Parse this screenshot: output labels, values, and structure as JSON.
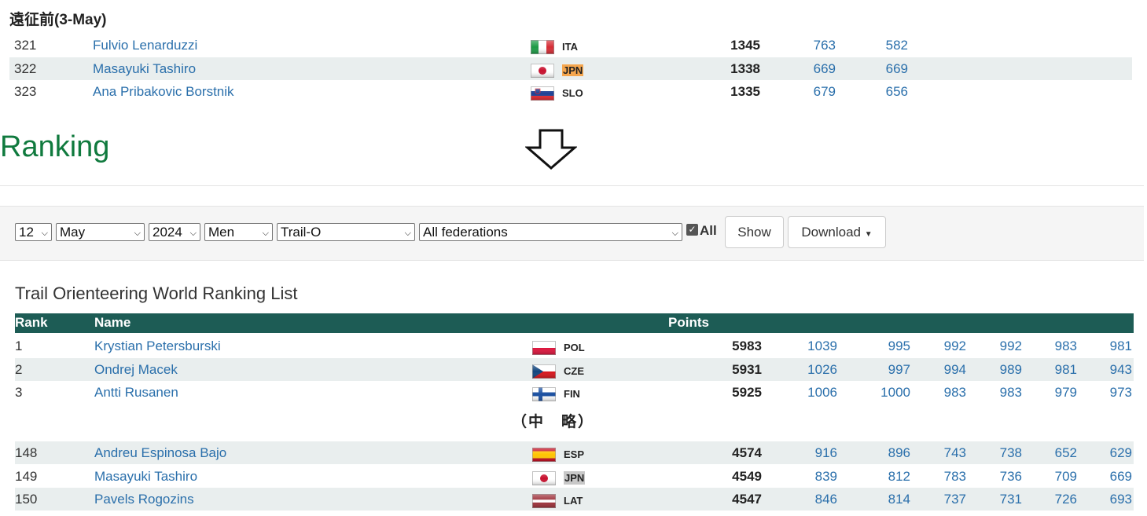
{
  "pre_section": {
    "title": "遠征前(3-May)",
    "rows": [
      {
        "rank": "321",
        "name": "Fulvio Lenarduzzi",
        "flag": "ITA",
        "code": "ITA",
        "points": "1345",
        "scores": [
          "763",
          "582"
        ],
        "highlight": ""
      },
      {
        "rank": "322",
        "name": "Masayuki Tashiro",
        "flag": "JPN",
        "code": "JPN",
        "points": "1338",
        "scores": [
          "669",
          "669"
        ],
        "highlight": "orange"
      },
      {
        "rank": "323",
        "name": "Ana Pribakovic Borstnik",
        "flag": "SLO",
        "code": "SLO",
        "points": "1335",
        "scores": [
          "679",
          "656"
        ],
        "highlight": ""
      }
    ]
  },
  "arrow_icon": "down-arrow-icon",
  "ranking_title": "Ranking",
  "filters": {
    "day": "12",
    "month": "May",
    "year": "2024",
    "gender": "Men",
    "discipline": "Trail-O",
    "federation": "All federations",
    "all_label": "All",
    "all_checked": true,
    "show_label": "Show",
    "download_label": "Download"
  },
  "list_title": "Trail Orienteering World Ranking List",
  "table_headers": {
    "rank": "Rank",
    "name": "Name",
    "points": "Points"
  },
  "top_rows": [
    {
      "rank": "1",
      "name": "Krystian Petersburski",
      "flag": "POL",
      "code": "POL",
      "points": "5983",
      "scores": [
        "1039",
        "995",
        "992",
        "992",
        "983",
        "981"
      ],
      "highlight": ""
    },
    {
      "rank": "2",
      "name": "Ondrej Macek",
      "flag": "CZE",
      "code": "CZE",
      "points": "5931",
      "scores": [
        "1026",
        "997",
        "994",
        "989",
        "981",
        "943"
      ],
      "highlight": ""
    },
    {
      "rank": "3",
      "name": "Antti Rusanen",
      "flag": "FIN",
      "code": "FIN",
      "points": "5925",
      "scores": [
        "1006",
        "1000",
        "983",
        "983",
        "979",
        "973"
      ],
      "highlight": ""
    }
  ],
  "omitted_label": "（中　略）",
  "bottom_rows": [
    {
      "rank": "148",
      "name": "Andreu Espinosa Bajo",
      "flag": "ESP",
      "code": "ESP",
      "points": "4574",
      "scores": [
        "916",
        "896",
        "743",
        "738",
        "652",
        "629"
      ],
      "highlight": ""
    },
    {
      "rank": "149",
      "name": "Masayuki Tashiro",
      "flag": "JPN",
      "code": "JPN",
      "points": "4549",
      "scores": [
        "839",
        "812",
        "783",
        "736",
        "709",
        "669"
      ],
      "highlight": "gray"
    },
    {
      "rank": "150",
      "name": "Pavels Rogozins",
      "flag": "LAT",
      "code": "LAT",
      "points": "4547",
      "scores": [
        "846",
        "814",
        "737",
        "731",
        "726",
        "693"
      ],
      "highlight": ""
    }
  ],
  "colors": {
    "link": "#2a6fab",
    "header_bg": "#1d5c55",
    "ranking_green": "#107a3e",
    "jpn_highlight_orange": "#f5a64e",
    "jpn_highlight_gray": "#c8c8c8"
  }
}
